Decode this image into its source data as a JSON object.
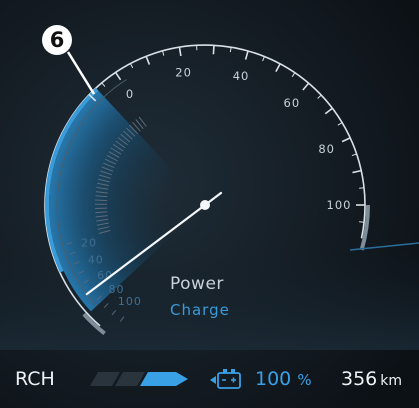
{
  "callout": {
    "number": "6"
  },
  "gauge": {
    "outer_ticks": [
      "0",
      "20",
      "40",
      "60",
      "80",
      "100"
    ],
    "inner_ticks": [
      "20",
      "40",
      "60",
      "80",
      "100"
    ],
    "mode_line1": "Power",
    "mode_line2": "Charge",
    "needle_value": 60,
    "outer_range": [
      0,
      100
    ],
    "inner_range": [
      0,
      100
    ]
  },
  "bottom_bar": {
    "rch_label": "RCH",
    "charge_level_segments_active": 1,
    "charge_level_segments_total": 3,
    "battery_percent": "100",
    "battery_percent_unit": "%",
    "range_value": "356",
    "range_unit": "km"
  },
  "colors": {
    "background": "#10161c",
    "accent_blue": "#3a9bd9",
    "text_white": "#eef3f6"
  }
}
